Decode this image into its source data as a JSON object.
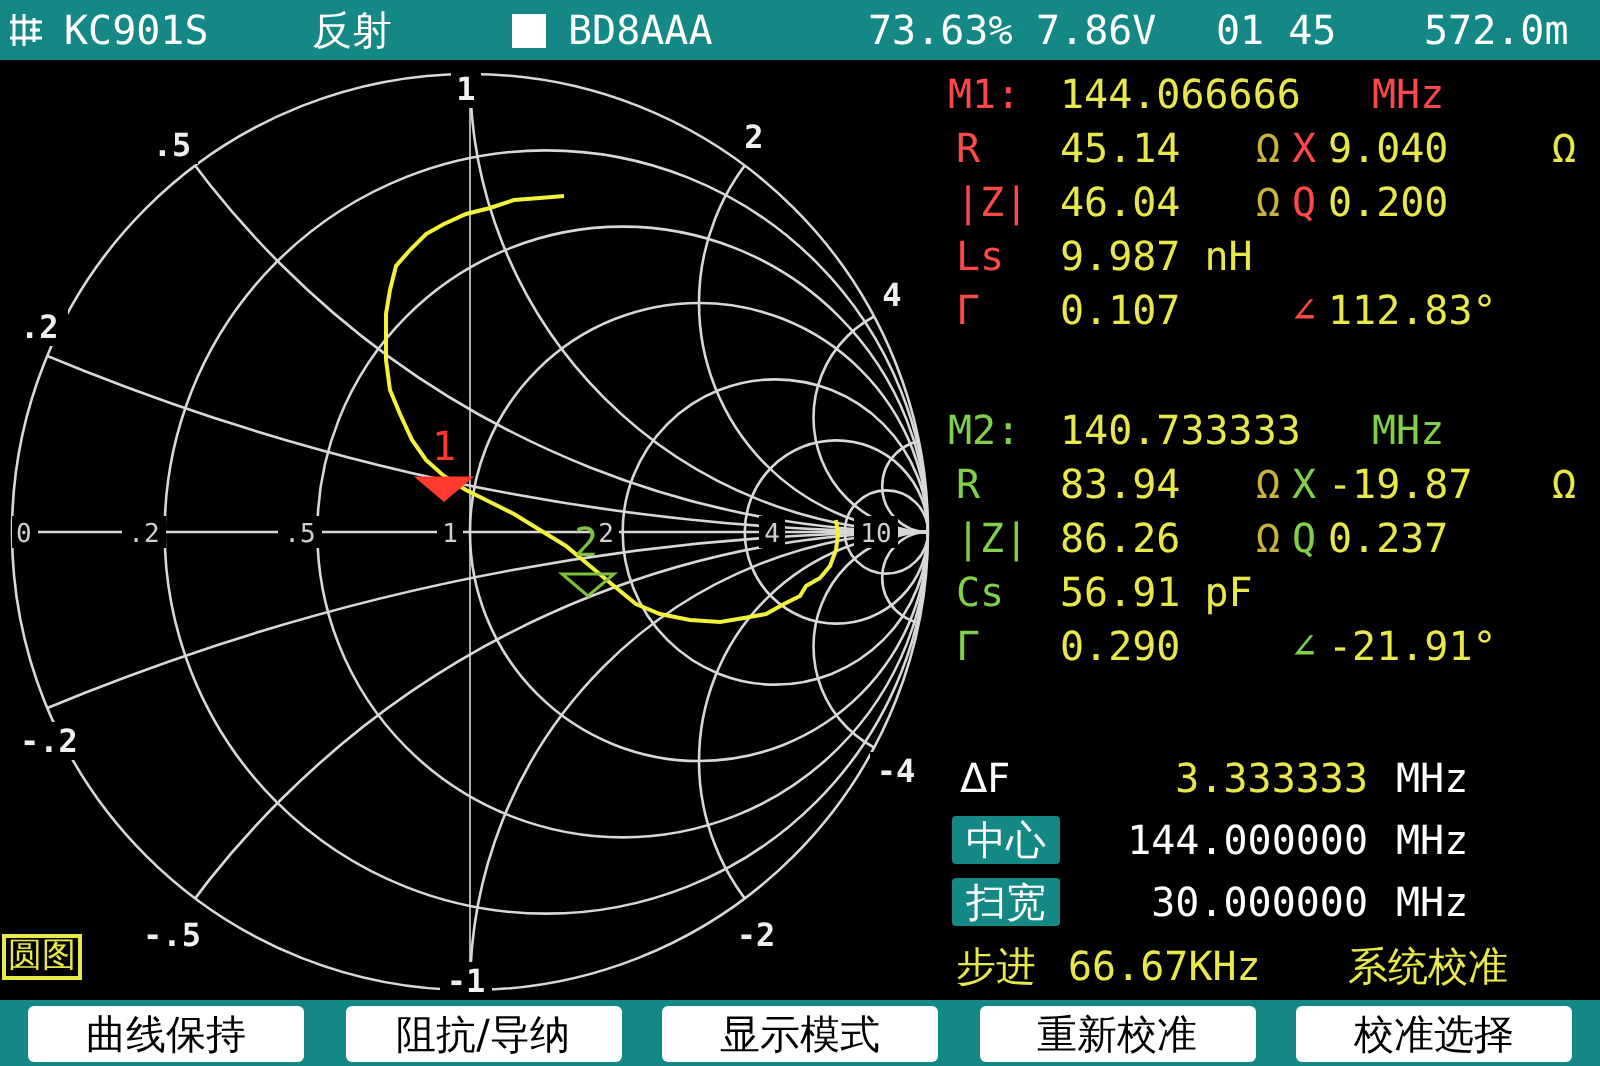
{
  "header": {
    "device": "KC901S",
    "mode": "反射",
    "callsign": "BD8AAA",
    "battery": "73.63%",
    "voltage": "7.86V",
    "time": "01 45",
    "length": "572.0m"
  },
  "smith_chart": {
    "real_labels": [
      "0",
      ".2",
      ".5",
      "1",
      "2",
      "4",
      "10"
    ],
    "reactance_labels": [
      "1",
      ".5",
      "2",
      ".2",
      "4",
      "-.2",
      "-4",
      "-.5",
      "-2",
      "-1"
    ],
    "markers": [
      {
        "label": "1",
        "color": "#ff3b30",
        "filled": true
      },
      {
        "label": "2",
        "color": "#7fc241",
        "filled": false
      }
    ],
    "title": "圆图"
  },
  "markers": [
    {
      "label": "M1:",
      "color": "#ff4848",
      "frequency": "144.066666",
      "unit": "MHz",
      "rows": [
        {
          "name": "R",
          "value": "45.14",
          "unit": "Ω",
          "name2": "X",
          "value2": "9.040",
          "unit2": "Ω"
        },
        {
          "name": "|Z|",
          "value": "46.04",
          "unit": "Ω",
          "name2": "Q",
          "value2": "0.200"
        },
        {
          "name": "Ls",
          "value": "9.987 nH"
        },
        {
          "name": "Γ",
          "value": "0.107",
          "name2": "∠",
          "value2": "112.83°"
        }
      ]
    },
    {
      "label": "M2:",
      "color": "#7fd14a",
      "frequency": "140.733333",
      "unit": "MHz",
      "rows": [
        {
          "name": "R",
          "value": "83.94",
          "unit": "Ω",
          "name2": "X",
          "value2": "-19.87",
          "unit2": "Ω"
        },
        {
          "name": "|Z|",
          "value": "86.26",
          "unit": "Ω",
          "name2": "Q",
          "value2": "0.237"
        },
        {
          "name": "Cs",
          "value": "56.91 pF"
        },
        {
          "name": "Γ",
          "value": "0.290",
          "name2": "∠",
          "value2": "-21.91°"
        }
      ]
    }
  ],
  "sweep": [
    {
      "kind": "plain",
      "label": "ΔF",
      "value": "3.333333",
      "unit": "MHz"
    },
    {
      "kind": "boxed",
      "label": "中心",
      "value": "144.000000",
      "unit": "MHz"
    },
    {
      "kind": "boxed",
      "label": "扫宽",
      "value": "30.000000",
      "unit": "MHz"
    }
  ],
  "step": {
    "label": "步进",
    "value": "66.67KHz",
    "status": "系统校准"
  },
  "buttons": [
    "曲线保持",
    "阻抗/导纳",
    "显示模式",
    "重新校准",
    "校准选择"
  ]
}
